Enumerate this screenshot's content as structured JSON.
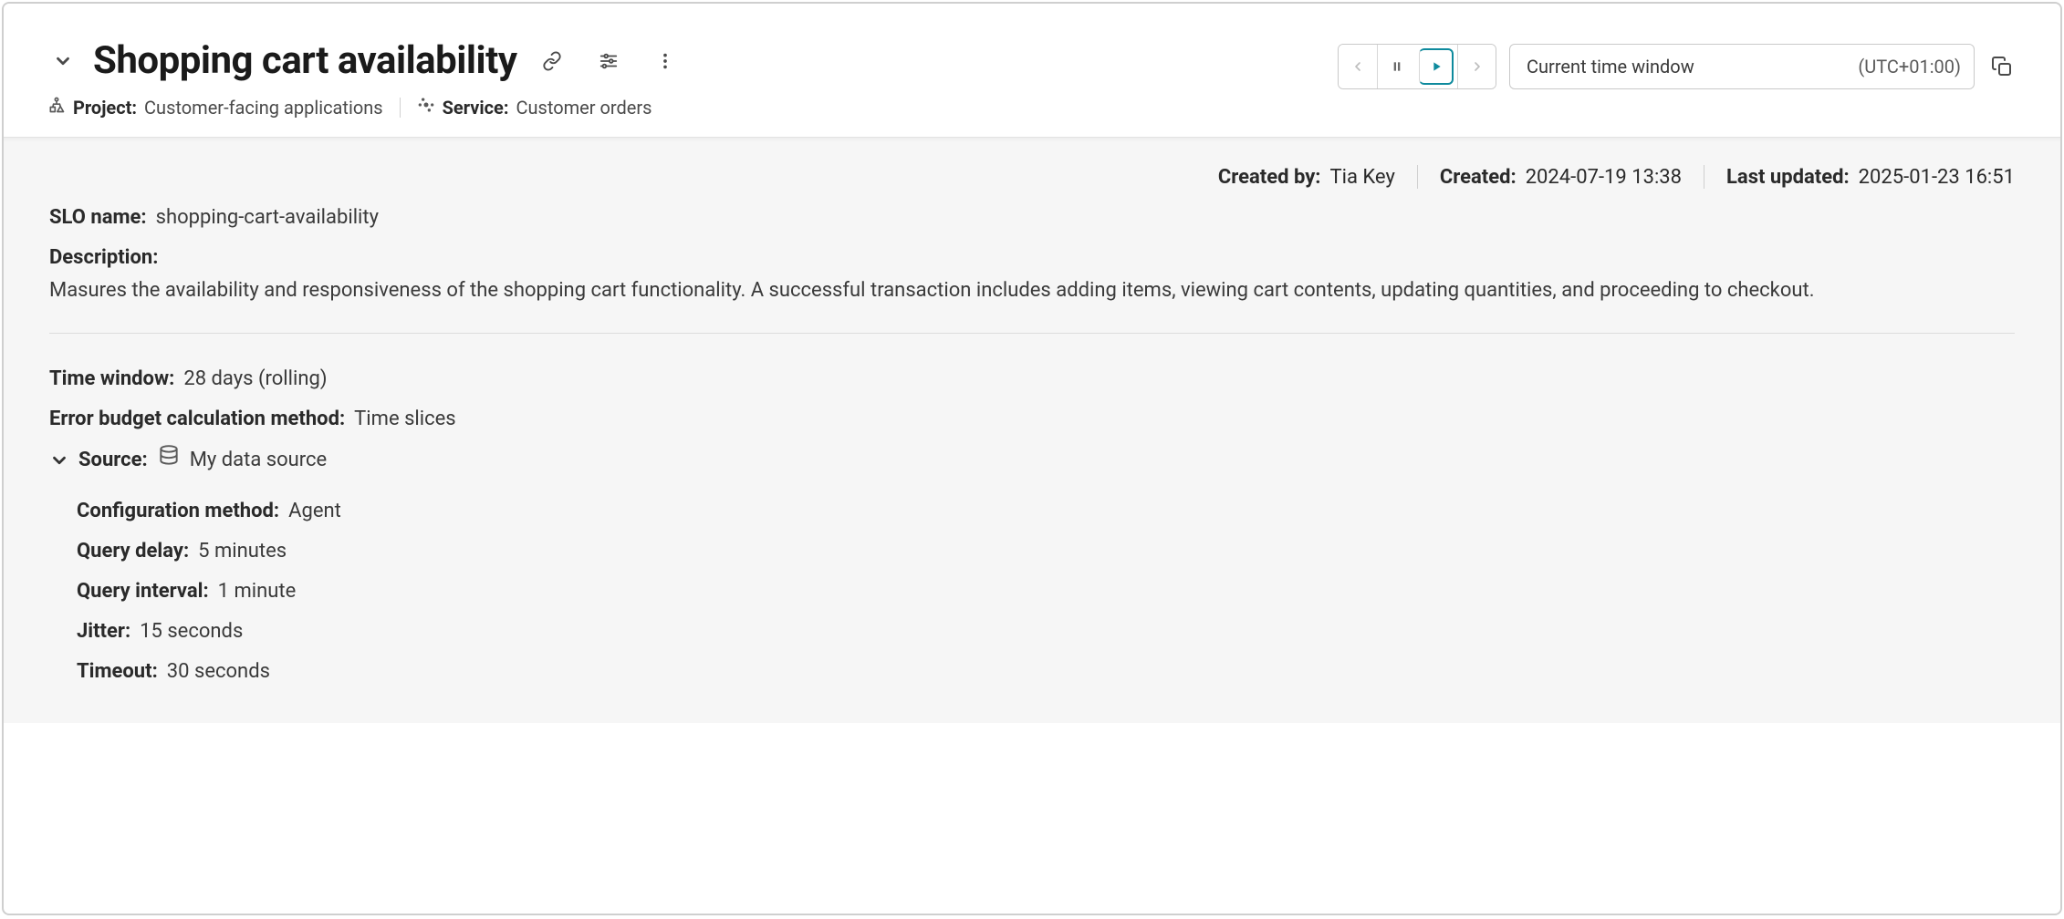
{
  "header": {
    "title": "Shopping cart availability",
    "project_label": "Project:",
    "project_value": "Customer-facing applications",
    "service_label": "Service:",
    "service_value": "Customer orders"
  },
  "toolbar": {
    "time_window_label": "Current time window",
    "timezone": "(UTC+01:00)"
  },
  "info": {
    "created_by_label": "Created by:",
    "created_by_value": "Tia Key",
    "created_label": "Created:",
    "created_value": "2024-07-19 13:38",
    "last_updated_label": "Last updated:",
    "last_updated_value": "2025-01-23 16:51"
  },
  "details": {
    "slo_name_label": "SLO name:",
    "slo_name_value": "shopping-cart-availability",
    "description_label": "Description:",
    "description_value": "Masures the availability and responsiveness of the shopping cart functionality. A successful transaction includes adding items, viewing cart contents, updating quantities, and proceeding to checkout.",
    "time_window_label": "Time window:",
    "time_window_value": "28 days (rolling)",
    "calc_method_label": "Error budget calculation method:",
    "calc_method_value": "Time slices",
    "source_label": "Source:",
    "source_value": "My data source",
    "config_method_label": "Configuration method:",
    "config_method_value": "Agent",
    "query_delay_label": "Query delay:",
    "query_delay_value": "5 minutes",
    "query_interval_label": "Query interval:",
    "query_interval_value": "1 minute",
    "jitter_label": "Jitter:",
    "jitter_value": "15 seconds",
    "timeout_label": "Timeout:",
    "timeout_value": "30 seconds"
  }
}
